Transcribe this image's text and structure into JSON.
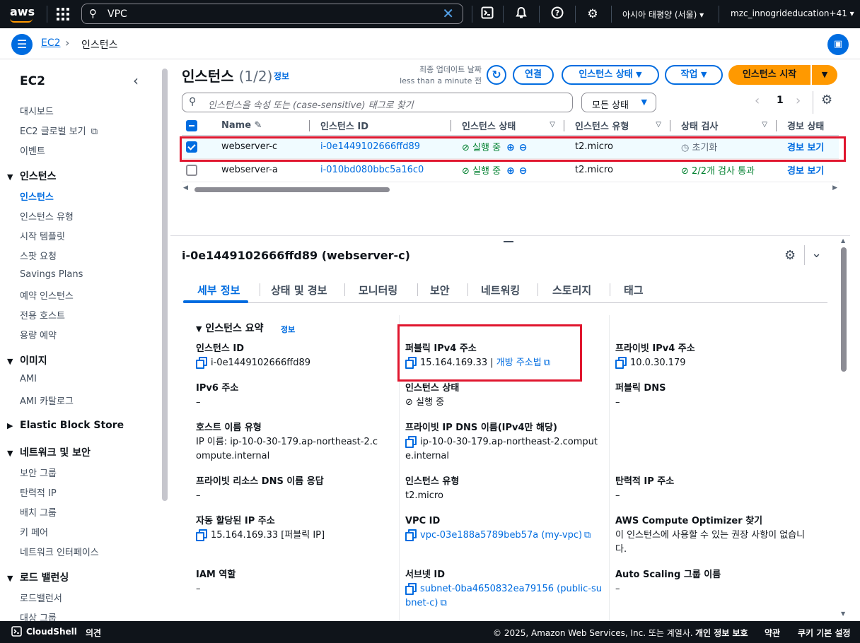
{
  "topnav": {
    "logo": "aws",
    "search_value": "VPC",
    "region": "아시아 태평양 (서울)",
    "account": "mzc_innogrideducation+41",
    "icons": [
      "grid-icon",
      "search-icon",
      "clear-icon",
      "cloudshell-icon",
      "bell-icon",
      "help-icon",
      "gear-icon"
    ]
  },
  "breadcrumb": {
    "root": "EC2",
    "current": "인스턴스"
  },
  "sidebar": {
    "title": "EC2",
    "top_items": [
      "대시보드",
      "EC2 글로벌 보기",
      "이벤트"
    ],
    "sections": [
      {
        "title": "인스턴스",
        "expanded": true,
        "items": [
          "인스턴스",
          "인스턴스 유형",
          "시작 템플릿",
          "스팟 요청",
          "Savings Plans",
          "예약 인스턴스",
          "전용 호스트",
          "용량 예약"
        ]
      },
      {
        "title": "이미지",
        "expanded": true,
        "items": [
          "AMI",
          "AMI 카탈로그"
        ]
      },
      {
        "title": "Elastic Block Store",
        "expanded": false,
        "items": []
      },
      {
        "title": "네트워크 및 보안",
        "expanded": true,
        "items": [
          "보안 그룹",
          "탄력적 IP",
          "배치 그룹",
          "키 페어",
          "네트워크 인터페이스"
        ]
      },
      {
        "title": "로드 밸런싱",
        "expanded": true,
        "items": [
          "로드밸런서",
          "대상 그룹"
        ]
      }
    ],
    "active_item": "인스턴스"
  },
  "instances": {
    "title": "인스턴스",
    "count": "(1/2)",
    "info": "정보",
    "last_updated_label": "최종 업데이트 날짜",
    "last_updated_value": "less than a minute 전",
    "buttons": {
      "connect": "연결",
      "state": "인스턴스 상태",
      "actions": "작업",
      "launch": "인스턴스 시작"
    },
    "filter_placeholder": "인스턴스을 속성 또는 (case-sensitive) 태그로 찾기",
    "state_filter": "모든 상태",
    "page": "1",
    "columns": [
      "Name",
      "인스턴스 ID",
      "인스턴스 상태",
      "인스턴스 유형",
      "상태 검사",
      "경보 상태"
    ],
    "rows": [
      {
        "selected": true,
        "name": "webserver-c",
        "id": "i-0e1449102666ffd89",
        "state": "실행 중",
        "type": "t2.micro",
        "check": "초기화",
        "alarm": "경보 보기"
      },
      {
        "selected": false,
        "name": "webserver-a",
        "id": "i-010bd080bbc5a16c0",
        "state": "실행 중",
        "type": "t2.micro",
        "check": "2/2개 검사 통과",
        "alarm": "경보 보기"
      }
    ]
  },
  "details": {
    "title": "i-0e1449102666ffd89 (webserver-c)",
    "tabs": [
      "세부 정보",
      "상태 및 경보",
      "모니터링",
      "보안",
      "네트워킹",
      "스토리지",
      "태그"
    ],
    "active_tab": "세부 정보",
    "summary_title": "인스턴스 요약",
    "summary_info": "정보",
    "fields": {
      "instance_id": {
        "label": "인스턴스 ID",
        "value": "i-0e1449102666ffd89"
      },
      "public_ipv4": {
        "label": "퍼블릭 IPv4 주소",
        "value": "15.164.169.33",
        "link": "개방 주소법"
      },
      "private_ipv4": {
        "label": "프라이빗 IPv4 주소",
        "value": "10.0.30.179"
      },
      "ipv6": {
        "label": "IPv6 주소",
        "value": "–"
      },
      "instance_state": {
        "label": "인스턴스 상태",
        "value": "실행 중"
      },
      "public_dns": {
        "label": "퍼블릭 DNS",
        "value": "–"
      },
      "hostname_type": {
        "label": "호스트 이름 유형",
        "value": "IP 이름: ip-10-0-30-179.ap-northeast-2.compute.internal"
      },
      "private_dns": {
        "label": "프라이빗 IP DNS 이름(IPv4만 해당)",
        "value": "ip-10-0-30-179.ap-northeast-2.compute.internal"
      },
      "private_resource_dns": {
        "label": "프라이빗 리소스 DNS 이름 응답",
        "value": "–"
      },
      "instance_type": {
        "label": "인스턴스 유형",
        "value": "t2.micro"
      },
      "elastic_ip": {
        "label": "탄력적 IP 주소",
        "value": "–"
      },
      "auto_ip": {
        "label": "자동 할당된 IP 주소",
        "value": "15.164.169.33 [퍼블릭 IP]"
      },
      "vpc_id": {
        "label": "VPC ID",
        "value": "vpc-03e188a5789beb57a (my-vpc)"
      },
      "optimizer": {
        "label": "AWS Compute Optimizer 찾기",
        "value": "이 인스턴스에 사용할 수 있는 권장 사항이 없습니다."
      },
      "iam_role": {
        "label": "IAM 역할",
        "value": "–"
      },
      "subnet_id": {
        "label": "서브넷 ID",
        "value": "subnet-0ba4650832ea79156 (public-subnet-c)"
      },
      "asg_name": {
        "label": "Auto Scaling 그룹 이름",
        "value": "–"
      }
    }
  },
  "footer": {
    "cloudshell": "CloudShell",
    "feedback": "의견",
    "copyright": "© 2025, Amazon Web Services, Inc. 또는 계열사.",
    "privacy": "개인 정보 보호",
    "terms": "약관",
    "cookies": "쿠키 기본 설정"
  },
  "colors": {
    "nav_bg": "#0f141a",
    "accent": "#006ce0",
    "primary_button": "#ff9900",
    "success": "#00802f",
    "highlight_box": "#e0162e"
  }
}
